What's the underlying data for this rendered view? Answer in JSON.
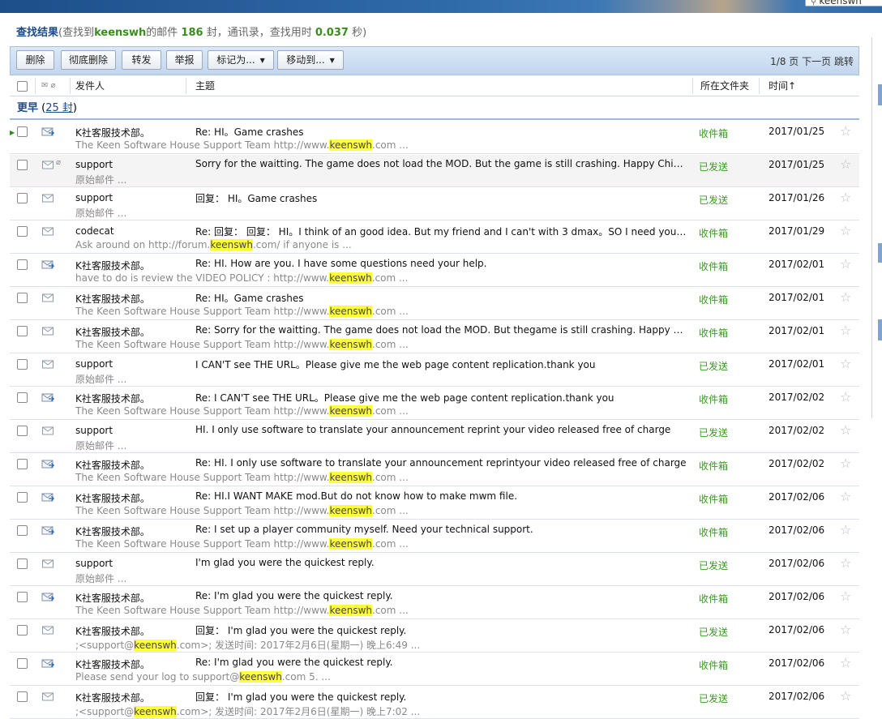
{
  "search_box": {
    "value": "keenswh"
  },
  "result_bar": {
    "title": "查找结果",
    "pre": "(查找到",
    "keyword": "keenswh",
    "mid1": "的邮件 ",
    "count": "186",
    "mid2": " 封，通讯录，查找用时 ",
    "time": "0.037",
    "post": " 秒)"
  },
  "toolbar": {
    "delete": "删除",
    "purge": "彻底删除",
    "forward": "转发",
    "report": "举报",
    "mark_as": "标记为...",
    "move_to": "移动到...",
    "pager_pages": "1/8 页",
    "pager_next": "下一页",
    "pager_jump": "跳转"
  },
  "columns": {
    "sender": "发件人",
    "subject": "主题",
    "folder": "所在文件夹",
    "time": "时间↑"
  },
  "group": {
    "label": "更早",
    "count_open": " (",
    "count": "25 封",
    "count_close": ")"
  },
  "colors": {
    "accent": "#1d4b88",
    "highlight": "#ffff38",
    "folder": "#3a9a22"
  },
  "rows": [
    {
      "sender": "K社客服技术部。",
      "subject": "Re: HI。Game crashes",
      "snippet_pre": "The Keen Software House Support Team http://www.",
      "snippet_hl": "keenswh",
      "snippet_post": ".com ...",
      "folder": "收件箱",
      "date": "2017/01/25",
      "icon": "reply-envelope-icon",
      "attach": false
    },
    {
      "sender": "support",
      "subject": "Sorry for the waitting. The game does not load the MOD. But the game is still crashing. Happy Chinese New Year!",
      "snippet_pre": "原始邮件  ...",
      "snippet_hl": "",
      "snippet_post": "",
      "folder": "已发送",
      "date": "2017/01/25",
      "icon": "envelope-icon",
      "attach": true
    },
    {
      "sender": "support",
      "subject": "回复： HI。Game crashes",
      "snippet_pre": "原始邮件  ...",
      "snippet_hl": "",
      "snippet_post": "",
      "folder": "已发送",
      "date": "2017/01/26",
      "icon": "envelope-icon",
      "attach": false
    },
    {
      "sender": "codecat",
      "subject": "Re: 回复： 回复： HI。I think of an good idea. But my friend and I can't with 3 dmax。SO I need your help",
      "snippet_pre": "Ask around on http://forum.",
      "snippet_hl": "keenswh",
      "snippet_post": ".com/ if anyone is ...",
      "folder": "收件箱",
      "date": "2017/01/29",
      "icon": "envelope-icon",
      "attach": false
    },
    {
      "sender": "K社客服技术部。",
      "subject": "Re: HI. How are you. I have some questions need your help.",
      "snippet_pre": "have to do is review the VIDEO POLICY : http://www.",
      "snippet_hl": "keenswh",
      "snippet_post": ".com ...",
      "folder": "收件箱",
      "date": "2017/02/01",
      "icon": "reply-envelope-icon",
      "attach": false
    },
    {
      "sender": "K社客服技术部。",
      "subject": "Re: HI。Game crashes",
      "snippet_pre": "The Keen Software House Support Team http://www.",
      "snippet_hl": "keenswh",
      "snippet_post": ".com ...",
      "folder": "收件箱",
      "date": "2017/02/01",
      "icon": "envelope-icon",
      "attach": false
    },
    {
      "sender": "K社客服技术部。",
      "subject": "Re: Sorry for the waitting. The game does not load the MOD. But thegame is still crashing. Happy Chinese New Year!",
      "snippet_pre": "The Keen Software House Support Team http://www.",
      "snippet_hl": "keenswh",
      "snippet_post": ".com ...",
      "folder": "收件箱",
      "date": "2017/02/01",
      "icon": "envelope-icon",
      "attach": false
    },
    {
      "sender": "support",
      "subject": "I CAN'T see THE URL。Please give me the web page content replication.thank you",
      "snippet_pre": "原始邮件  ...",
      "snippet_hl": "",
      "snippet_post": "",
      "folder": "已发送",
      "date": "2017/02/01",
      "icon": "envelope-icon",
      "attach": false
    },
    {
      "sender": "K社客服技术部。",
      "subject": "Re: I CAN'T see THE URL。Please give me the web page content replication.thank you",
      "snippet_pre": "The Keen Software House Support Team http://www.",
      "snippet_hl": "keenswh",
      "snippet_post": ".com ...",
      "folder": "收件箱",
      "date": "2017/02/02",
      "icon": "reply-envelope-icon",
      "attach": false
    },
    {
      "sender": "support",
      "subject": "HI. I only use software to translate your announcement reprint your video released free of charge",
      "snippet_pre": "原始邮件  ...",
      "snippet_hl": "",
      "snippet_post": "",
      "folder": "已发送",
      "date": "2017/02/02",
      "icon": "envelope-icon",
      "attach": false
    },
    {
      "sender": "K社客服技术部。",
      "subject": "Re: HI. I only use software to translate your announcement reprintyour video released free of charge",
      "snippet_pre": "The Keen Software House Support Team http://www.",
      "snippet_hl": "keenswh",
      "snippet_post": ".com ...",
      "folder": "收件箱",
      "date": "2017/02/02",
      "icon": "reply-envelope-icon",
      "attach": false
    },
    {
      "sender": "K社客服技术部。",
      "subject": "Re: HI.I WANT MAKE mod.But do not know how to make mwm file.",
      "snippet_pre": "The Keen Software House Support Team http://www.",
      "snippet_hl": "keenswh",
      "snippet_post": ".com ...",
      "folder": "收件箱",
      "date": "2017/02/06",
      "icon": "reply-envelope-icon",
      "attach": false
    },
    {
      "sender": "K社客服技术部。",
      "subject": "Re: I set up a player community myself. Need your technical support.",
      "snippet_pre": "The Keen Software House Support Team http://www.",
      "snippet_hl": "keenswh",
      "snippet_post": ".com ...",
      "folder": "收件箱",
      "date": "2017/02/06",
      "icon": "reply-envelope-icon",
      "attach": false
    },
    {
      "sender": "support",
      "subject": "I'm glad you were the quickest reply.",
      "snippet_pre": "原始邮件  ...",
      "snippet_hl": "",
      "snippet_post": "",
      "folder": "已发送",
      "date": "2017/02/06",
      "icon": "envelope-icon",
      "attach": false
    },
    {
      "sender": "K社客服技术部。",
      "subject": "Re: I'm glad you were the quickest reply.",
      "snippet_pre": "The Keen Software House Support Team http://www.",
      "snippet_hl": "keenswh",
      "snippet_post": ".com ...",
      "folder": "收件箱",
      "date": "2017/02/06",
      "icon": "reply-envelope-icon",
      "attach": false
    },
    {
      "sender": "K社客服技术部。",
      "subject": "回复： I'm glad you were the quickest reply.",
      "snippet_pre": ";<support@",
      "snippet_hl": "keenswh",
      "snippet_post": ".com>; 发送时间: 2017年2月6日(星期一) 晚上6:49 ...",
      "folder": "已发送",
      "date": "2017/02/06",
      "icon": "envelope-icon",
      "attach": false
    },
    {
      "sender": "K社客服技术部。",
      "subject": "Re: I'm glad you were the quickest reply.",
      "snippet_pre": "Please send your log to support@",
      "snippet_hl": "keenswh",
      "snippet_post": ".com 5. ...",
      "folder": "收件箱",
      "date": "2017/02/06",
      "icon": "reply-envelope-icon",
      "attach": false
    },
    {
      "sender": "K社客服技术部。",
      "subject": "回复： I'm glad you were the quickest reply.",
      "snippet_pre": ";<support@",
      "snippet_hl": "keenswh",
      "snippet_post": ".com>; 发送时间: 2017年2月6日(星期一) 晚上7:02 ...",
      "folder": "已发送",
      "date": "2017/02/06",
      "icon": "envelope-icon",
      "attach": false
    }
  ]
}
